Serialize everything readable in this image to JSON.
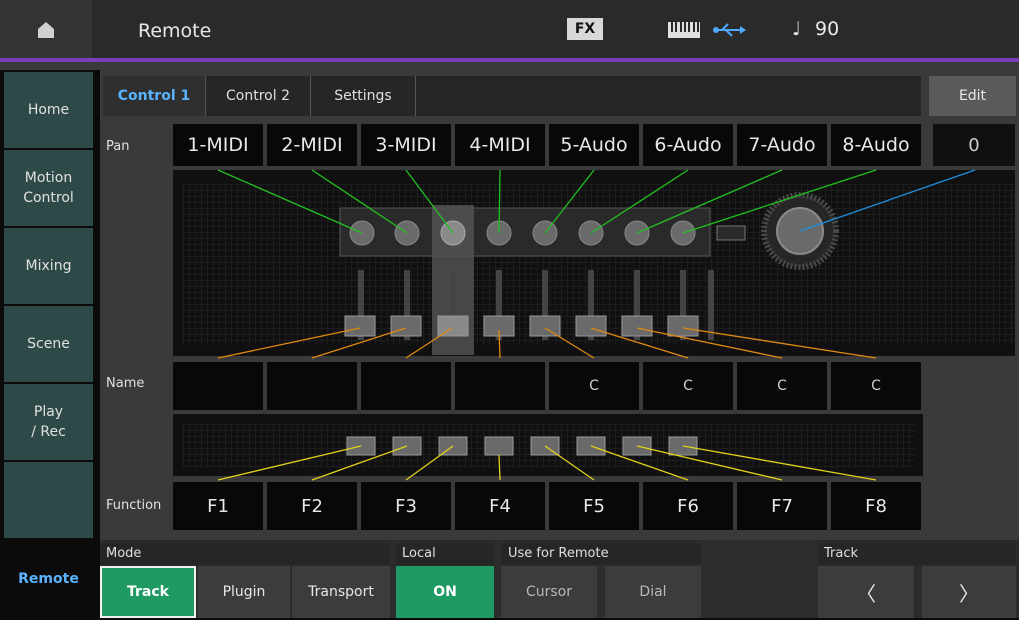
{
  "header": {
    "title": "Remote",
    "fx_label": "FX",
    "tempo_symbol": "♩",
    "tempo": "90"
  },
  "sidebar": {
    "items": [
      {
        "label": "Home"
      },
      {
        "label": "Motion\nControl"
      },
      {
        "label": "Mixing"
      },
      {
        "label": "Scene"
      },
      {
        "label": "Play\n/ Rec"
      },
      {
        "label": ""
      },
      {
        "label": "Remote"
      }
    ]
  },
  "tabs": [
    "Control 1",
    "Control 2",
    "Settings"
  ],
  "edit_label": "Edit",
  "rows": {
    "pan_label": "Pan",
    "name_label": "Name",
    "function_label": "Function"
  },
  "tracks": [
    "1-MIDI",
    "2-MIDI",
    "3-MIDI",
    "4-MIDI",
    "5-Audo",
    "6-Audo",
    "7-Audo",
    "8-Audo"
  ],
  "dial_value": "0",
  "names": [
    "",
    "",
    "",
    "",
    "C",
    "C",
    "C",
    "C"
  ],
  "functions": [
    "F1",
    "F2",
    "F3",
    "F4",
    "F5",
    "F6",
    "F7",
    "F8"
  ],
  "bottom": {
    "mode_label": "Mode",
    "mode_buttons": [
      "Track",
      "Plugin",
      "Transport"
    ],
    "local_label": "Local",
    "local_value": "ON",
    "use_label": "Use for Remote",
    "use_buttons": [
      "Cursor",
      "Dial"
    ],
    "track_label": "Track",
    "track_prev": "〈",
    "track_next": "〉"
  },
  "colors": {
    "accent": "#5ab3ff",
    "selected": "#1f9a63",
    "header_line": "#7a3fb6",
    "knob_line": "#22c022",
    "fader_line": "#e08a10",
    "button_line": "#e0d21a",
    "dial_line": "#1e8ee0"
  }
}
